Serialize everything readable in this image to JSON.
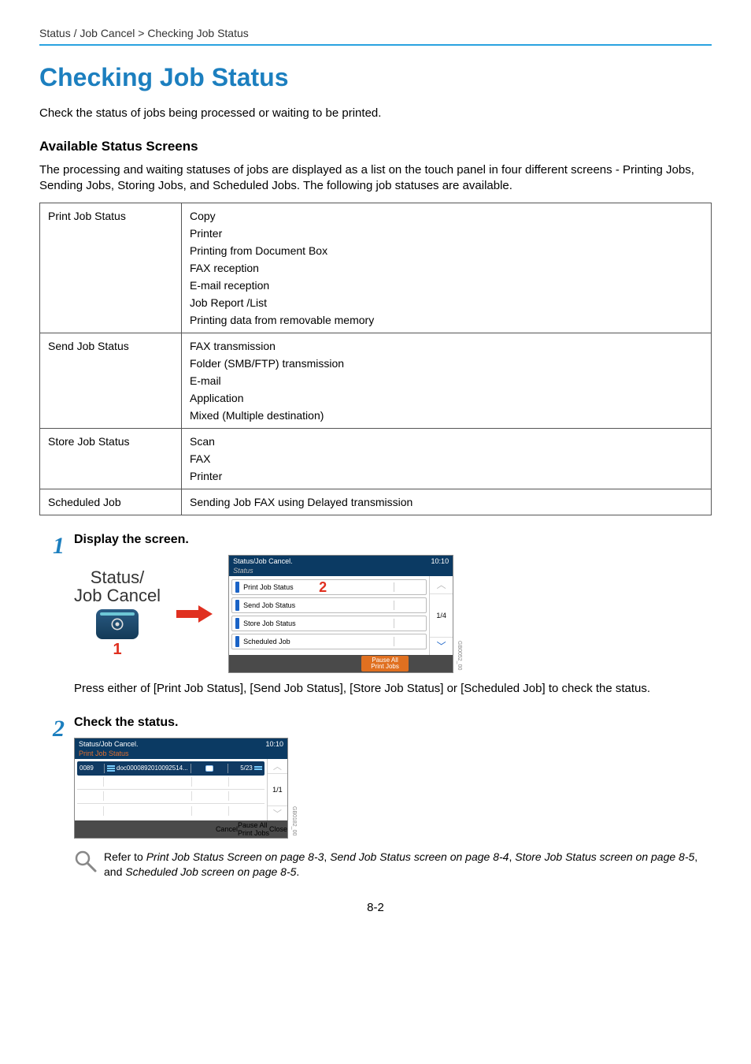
{
  "breadcrumb": "Status / Job Cancel > Checking Job Status",
  "title": "Checking Job Status",
  "intro": "Check the status of jobs being processed or waiting to be printed.",
  "available": {
    "heading": "Available Status Screens",
    "desc": "The processing and waiting statuses of jobs are displayed as a list on the touch panel in four different screens - Printing Jobs, Sending Jobs, Storing Jobs, and Scheduled Jobs. The following job statuses are available."
  },
  "table": [
    {
      "left": "Print Job Status",
      "right": [
        "Copy",
        "Printer",
        "Printing from Document Box",
        "FAX reception",
        "E-mail reception",
        "Job Report /List",
        "Printing data from removable memory"
      ]
    },
    {
      "left": "Send Job Status",
      "right": [
        "FAX transmission",
        "Folder (SMB/FTP) transmission",
        "E-mail",
        "Application",
        "Mixed (Multiple destination)"
      ]
    },
    {
      "left": "Store Job Status",
      "right": [
        "Scan",
        "FAX",
        "Printer"
      ]
    },
    {
      "left": "Scheduled Job",
      "right": [
        "Sending Job FAX using Delayed transmission"
      ]
    }
  ],
  "step1": {
    "num": "1",
    "title": "Display the screen.",
    "btnLabel1": "Status/",
    "btnLabel2": "Job Cancel",
    "badge": "1",
    "panel": {
      "title": "Status/Job Cancel.",
      "time": "10:10",
      "subtitle": "Status",
      "items": [
        "Print Job Status",
        "Send Job Status",
        "Store Job Status",
        "Scheduled Job"
      ],
      "page": "1/4",
      "pauseBtn": "Pause All\nPrint Jobs",
      "callout": "2",
      "code": "GB0052_00"
    },
    "body": "Press either of [Print Job Status], [Send Job Status], [Store Job Status] or [Scheduled Job] to check the status."
  },
  "step2": {
    "num": "2",
    "title": "Check the status.",
    "panel": {
      "title": "Status/Job Cancel.",
      "time": "10:10",
      "subtitle": "Print Job Status",
      "row": {
        "no": "0089",
        "name": "doc0000892010092514...",
        "count": "5/23"
      },
      "page": "1/1",
      "cancelBtn": "Cancel",
      "pauseBtn": "Pause All\nPrint Jobs",
      "closeBtn": "Close",
      "code": "GB0182_00"
    },
    "note_pre": "Refer to ",
    "note_l1": "Print Job Status Screen on page 8-3",
    "note_s1": ", ",
    "note_l2": "Send Job Status screen on page 8-4",
    "note_s2": ", ",
    "note_l3": "Store Job Status screen on page 8-5",
    "note_s3": ", and ",
    "note_l4": "Scheduled Job screen on page 8-5",
    "note_post": "."
  },
  "pagenum": "8-2"
}
